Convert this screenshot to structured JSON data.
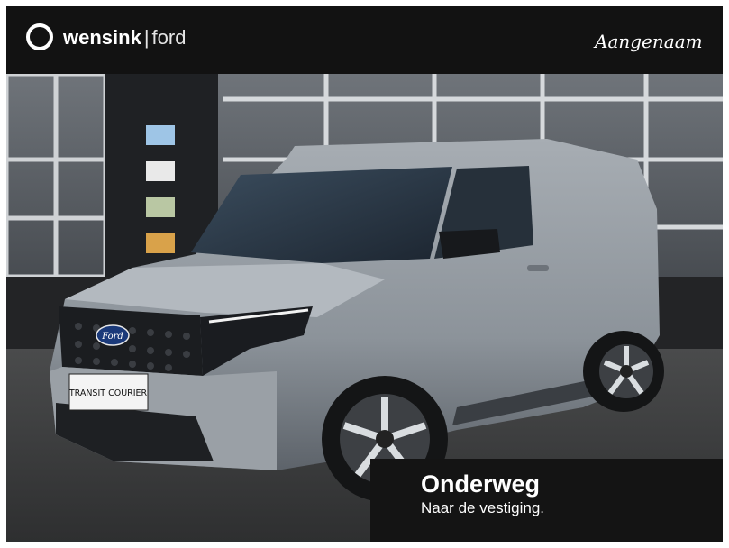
{
  "header": {
    "brand": "wensink",
    "separator": "|",
    "sub_brand": "ford",
    "signature": "Aangenaam"
  },
  "vehicle": {
    "grille_logo": "Ford",
    "plate": "TRANSIT COURIER",
    "body_color": "#8f969e"
  },
  "badge": {
    "title": "Onderweg",
    "subtitle": "Naar de vestiging."
  },
  "icons": {
    "logo": "circle-ring-icon"
  }
}
